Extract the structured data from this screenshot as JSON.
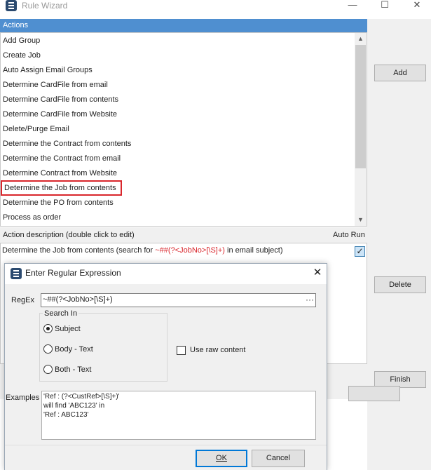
{
  "window": {
    "title": "Rule Wizard",
    "minimize_glyph": "—",
    "maximize_glyph": "☐",
    "close_glyph": "✕"
  },
  "actions": {
    "header": "Actions",
    "items": [
      "Add Group",
      "Create Job",
      "Auto Assign Email Groups",
      "Determine CardFile from email",
      "Determine CardFile from contents",
      "Determine CardFile from Website",
      "Delete/Purge Email",
      "Determine the Contract from contents",
      "Determine the Contract from email",
      "Determine Contract from Website",
      "Determine the Job from contents",
      "Determine the PO from contents",
      "Process as order"
    ],
    "highlighted_index": 10
  },
  "buttons": {
    "add": "Add",
    "delete": "Delete",
    "finish": "Finish"
  },
  "description": {
    "header": "Action description (double click to edit)",
    "autorun_header": "Auto Run",
    "text_prefix": "Determine the Job from contents (search for ",
    "text_pattern": "~##(?<JobNo>[\\S]+)",
    "text_suffix": " in email subject)",
    "autorun_checked": true
  },
  "dialog": {
    "title": "Enter Regular Expression",
    "close_glyph": "✕",
    "regex_label": "RegEx",
    "regex_value": "~##(?<JobNo>[\\S]+)",
    "ellipsis": "···",
    "search_in_label": "Search In",
    "options": [
      {
        "label": "Subject",
        "checked": true
      },
      {
        "label": "Body - Text",
        "checked": false
      },
      {
        "label": "Both - Text",
        "checked": false
      }
    ],
    "raw_content_label": "Use raw content",
    "raw_content_checked": false,
    "examples_label": "Examples",
    "examples_lines": [
      "'Ref : (?<CustRef>[\\S]+)'",
      "will find 'ABC123' in",
      "'Ref : ABC123'"
    ],
    "ok_label": "OK",
    "cancel_label": "Cancel"
  },
  "colors": {
    "header_blue": "#4f8fd0",
    "highlight_red": "#d9262c",
    "dialog_bg": "#f0f0f0"
  }
}
